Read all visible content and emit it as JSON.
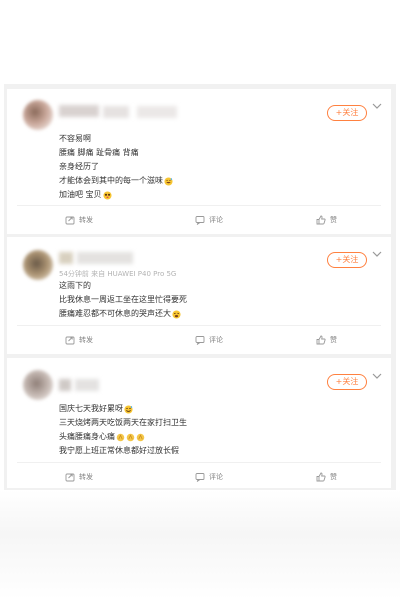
{
  "colors": {
    "feed_background": "#f1f1f1",
    "card_background": "#ffffff",
    "accent_orange": "#ff8140",
    "body_text": "#333333",
    "meta_text": "#b3b3b3",
    "action_text": "#808080"
  },
  "posts": [
    {
      "follow_label": "+关注",
      "meta": "",
      "lines": [
        "不容易啊",
        "腰痛 脚痛 趾骨痛 背痛",
        "亲身经历了",
        "才能体会到其中的每一个滋味",
        "加油吧 宝贝"
      ],
      "line_emojis": [
        "",
        "",
        "",
        "grinning-sweat-emoji",
        "pleading-face-emoji"
      ],
      "actions": {
        "repost": "转发",
        "comment": "评论",
        "like": "赞"
      }
    },
    {
      "follow_label": "+关注",
      "meta": "54分钟前 来自 HUAWEI P40 Pro 5G",
      "lines": [
        "这雨下的",
        "比我休息一周返工坐在这里忙得要死",
        "腰痛难忍都不可休息的哭声还大"
      ],
      "line_emojis": [
        "",
        "",
        "tired-face-emoji"
      ],
      "actions": {
        "repost": "转发",
        "comment": "评论",
        "like": "赞"
      }
    },
    {
      "follow_label": "+关注",
      "meta": "",
      "lines": [
        "国庆七天我好累呀",
        "三天烧烤两天吃饭两天在家打扫卫生",
        "头痛腰痛身心痛",
        "我宁愿上班正常休息都好过放长假"
      ],
      "line_emojis": [
        "sweat-smile-emoji",
        "",
        "clapping-hands-emoji",
        ""
      ],
      "actions": {
        "repost": "转发",
        "comment": "评论",
        "like": "赞"
      }
    }
  ]
}
